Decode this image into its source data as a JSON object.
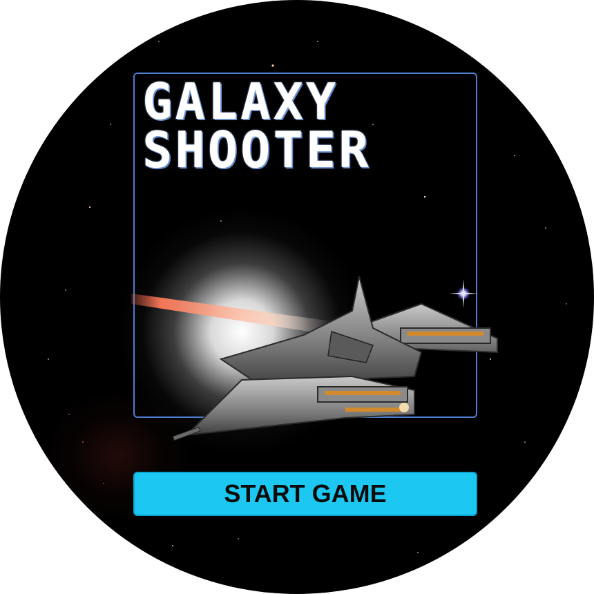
{
  "game": {
    "title_line1": "GALAXY",
    "title_line2": "SHOOTER",
    "start_button_label": "START GAME"
  },
  "colors": {
    "background": "#000000",
    "frame_border": "#4c7fd0",
    "button_fill": "#1cc7f2",
    "button_text": "#0b0b0b",
    "title_text": "#ffffff"
  },
  "icons": {
    "ship": "spaceship-icon",
    "star": "bright-star-icon"
  }
}
